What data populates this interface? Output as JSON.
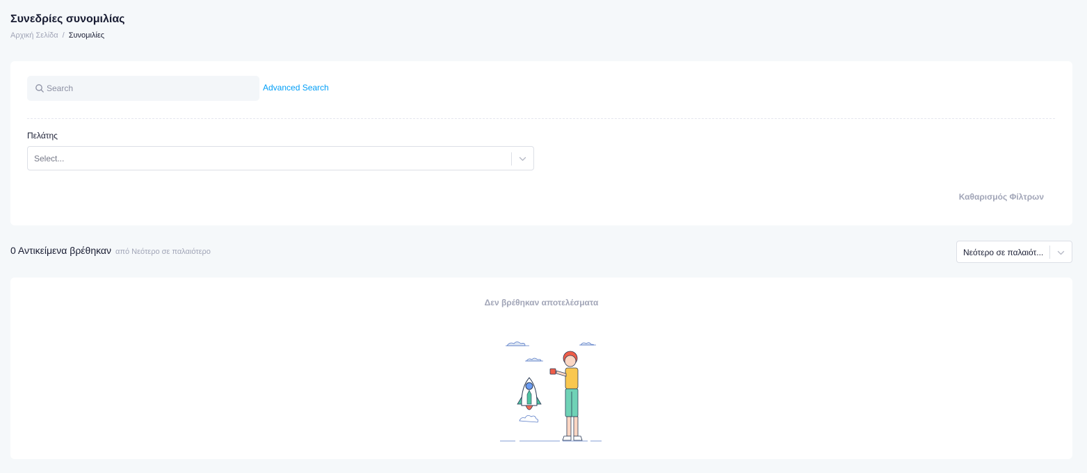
{
  "header": {
    "title": "Συνεδρίες συνομιλίας",
    "breadcrumb": {
      "home": "Αρχική Σελίδα",
      "separator": "/",
      "current": "Συνομιλίες"
    }
  },
  "filters": {
    "search_placeholder": "Search",
    "advanced_search_label": "Advanced Search",
    "customer_label": "Πελάτης",
    "customer_placeholder": "Select...",
    "clear_filters_label": "Καθαρισμός Φίλτρων"
  },
  "results": {
    "count_text": "0 Αντικείμενα βρέθηκαν",
    "sort_text": "από Νεότερο σε παλαιότερο",
    "sort_selected": "Νεότερο σε παλαιότ...",
    "empty_text": "Δεν βρέθηκαν αποτελέσματα"
  },
  "icons": {
    "search": "search-icon",
    "chevron": "chevron-down-icon",
    "illustration": "rocket-launch-illustration"
  },
  "colors": {
    "accent": "#009ef7",
    "background": "#f5f8fa",
    "muted": "#a1a5b7"
  }
}
